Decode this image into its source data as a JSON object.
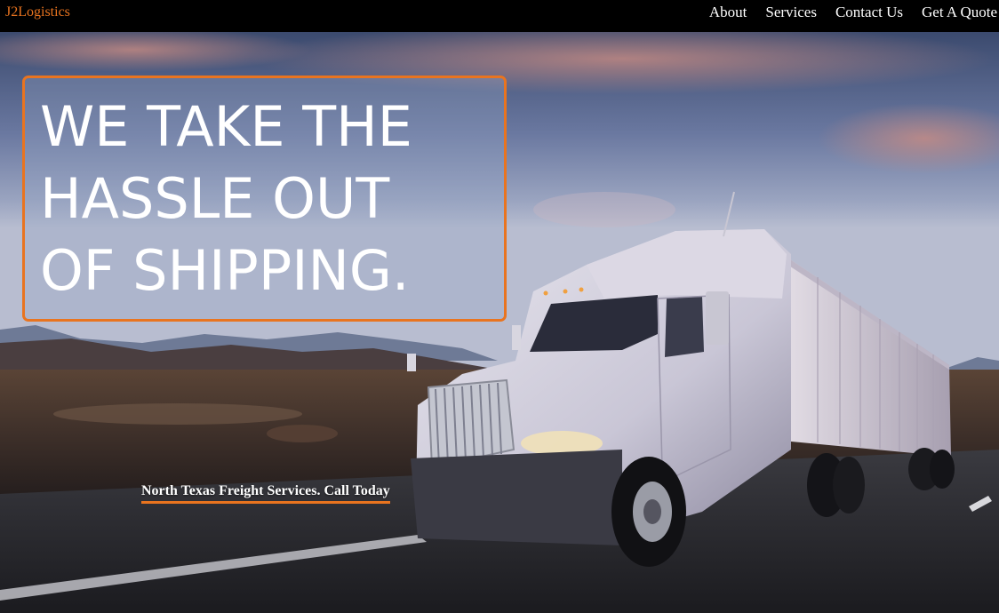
{
  "nav": {
    "brand": "J2Logistics",
    "links": [
      "About",
      "Services",
      "Contact Us",
      "Get A Quote"
    ]
  },
  "hero": {
    "headline": [
      "WE TAKE THE",
      "HASSLE OUT",
      "OF SHIPPING."
    ],
    "cta": "North Texas Freight Services. Call Today",
    "image": "semi-truck-on-highway"
  },
  "colors": {
    "accent": "#e9741f",
    "nav_bg": "#000000",
    "text": "#ffffff"
  }
}
